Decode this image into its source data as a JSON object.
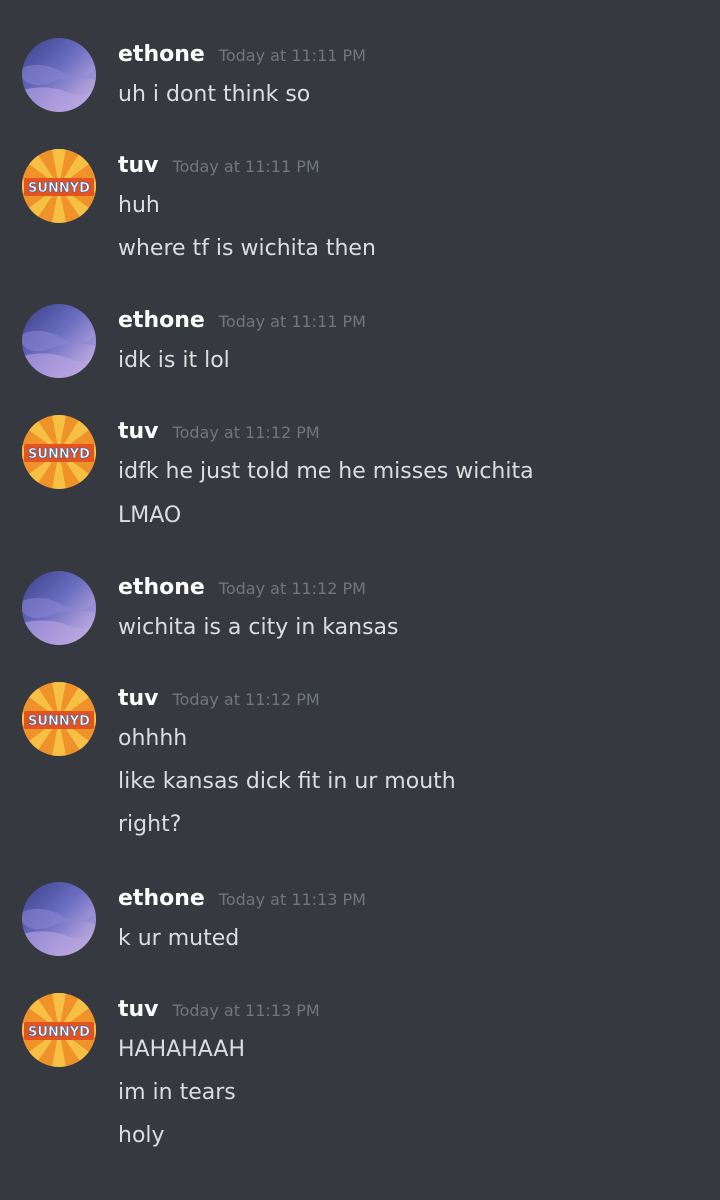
{
  "messages": [
    {
      "user": "ethone",
      "time": "Today at 11:11 PM",
      "avatar": "purple-sky-avatar",
      "lines": [
        "uh i dont think so"
      ]
    },
    {
      "user": "tuv",
      "time": "Today at 11:11 PM",
      "avatar": "sunnyd-avatar",
      "lines": [
        "huh",
        "where tf is wichita then"
      ]
    },
    {
      "user": "ethone",
      "time": "Today at 11:11 PM",
      "avatar": "purple-sky-avatar",
      "lines": [
        "idk is it lol"
      ]
    },
    {
      "user": "tuv",
      "time": "Today at 11:12 PM",
      "avatar": "sunnyd-avatar",
      "lines": [
        "idfk he just told me he misses wichita",
        "LMAO"
      ]
    },
    {
      "user": "ethone",
      "time": "Today at 11:12 PM",
      "avatar": "purple-sky-avatar",
      "lines": [
        "wichita is a city in kansas"
      ]
    },
    {
      "user": "tuv",
      "time": "Today at 11:12 PM",
      "avatar": "sunnyd-avatar",
      "lines": [
        "ohhhh",
        "like kansas dick fit in ur mouth",
        "right?"
      ]
    },
    {
      "user": "ethone",
      "time": "Today at 11:13 PM",
      "avatar": "purple-sky-avatar",
      "lines": [
        "k ur muted"
      ]
    },
    {
      "user": "tuv",
      "time": "Today at 11:13 PM",
      "avatar": "sunnyd-avatar",
      "lines": [
        "HAHAHAAH",
        "im in tears",
        "holy"
      ]
    }
  ],
  "sunnyd_logo_text": "SUNNYD",
  "colors": {
    "background": "#36393f",
    "username": "#ffffff",
    "timestamp": "#72767d",
    "message_text": "#dcddde",
    "sunnyd_orange": "#f0922a"
  }
}
